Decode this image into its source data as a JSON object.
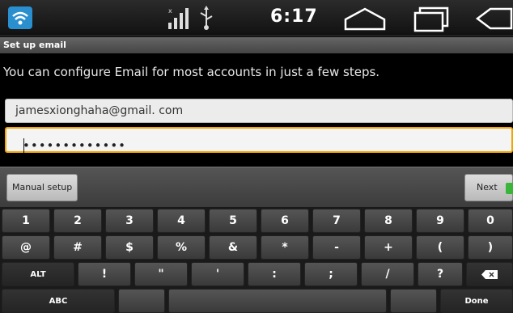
{
  "status_bar": {
    "time": "6:17"
  },
  "title_bar": {
    "title": "Set up email"
  },
  "content": {
    "instructions": "You can configure Email for most accounts in just a few steps.",
    "email_value": "jamesxionghaha@gmail. com",
    "password_mask": "•••••••••••••"
  },
  "actions": {
    "manual_setup": "Manual setup",
    "next": "Next"
  },
  "keyboard": {
    "row1": [
      "1",
      "2",
      "3",
      "4",
      "5",
      "6",
      "7",
      "8",
      "9",
      "0"
    ],
    "row2": [
      "@",
      "#",
      "$",
      "%",
      "&",
      "*",
      "-",
      "+",
      "(",
      ")"
    ],
    "row3_alt": "ALT",
    "row3": [
      "!",
      "\"",
      "'",
      ":",
      ";",
      "/",
      "?"
    ],
    "row4_abc": "ABC",
    "row4_done": "Done"
  },
  "colors": {
    "focus": "#f0a500",
    "wifi": "#2a8fcf",
    "next_arrow": "#3ab53a"
  }
}
